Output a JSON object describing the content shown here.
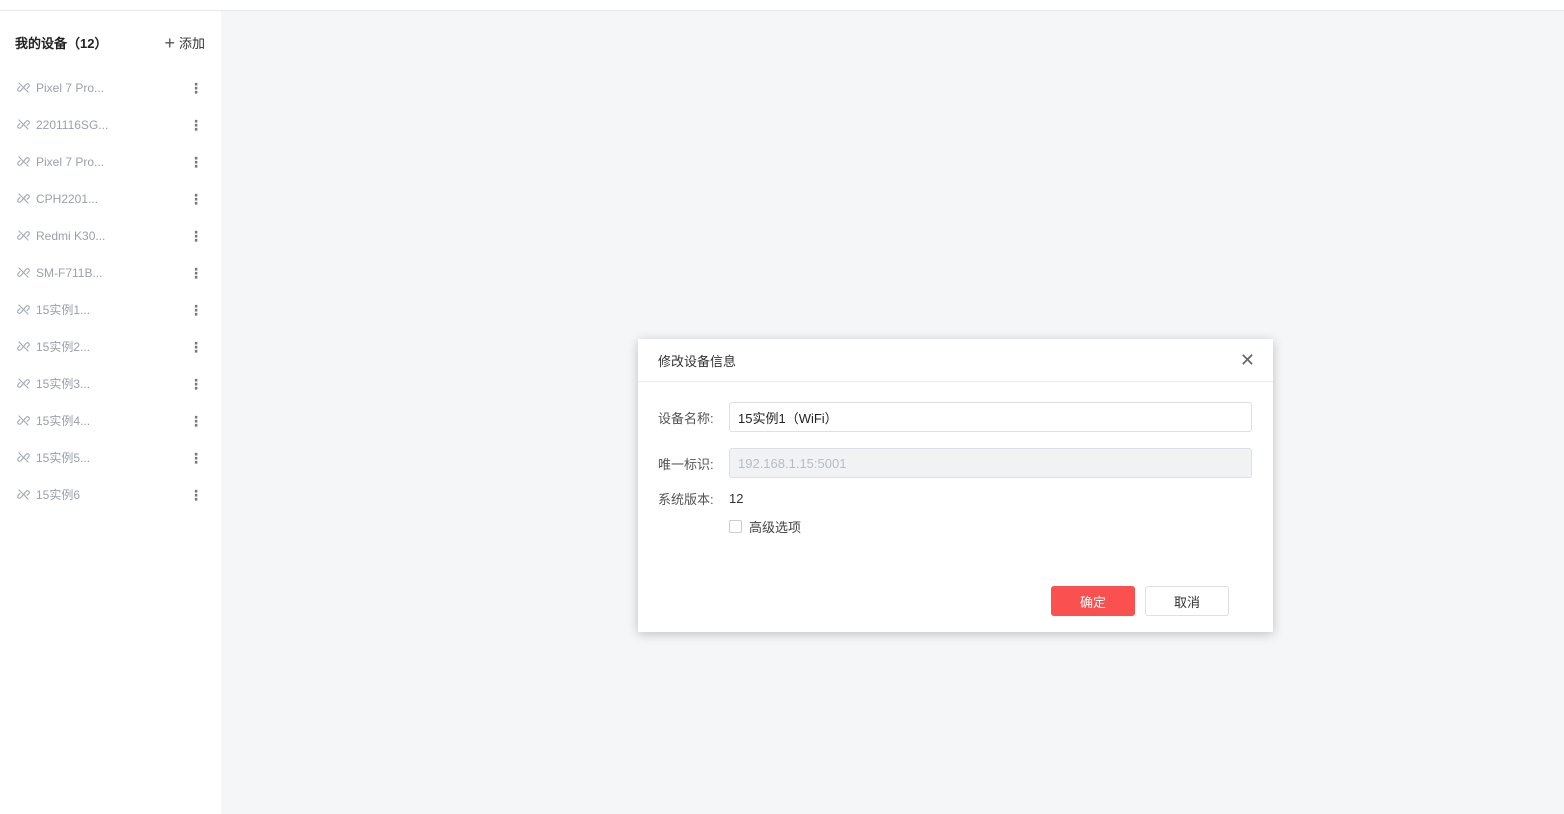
{
  "sidebar": {
    "title": "我的设备（12）",
    "add_label": "添加",
    "items": [
      {
        "label": "Pixel 7 Pro..."
      },
      {
        "label": "2201116SG..."
      },
      {
        "label": "Pixel 7 Pro..."
      },
      {
        "label": "CPH2201..."
      },
      {
        "label": "Redmi K30..."
      },
      {
        "label": "SM-F711B..."
      },
      {
        "label": "15实例1..."
      },
      {
        "label": "15实例2..."
      },
      {
        "label": "15实例3..."
      },
      {
        "label": "15实例4..."
      },
      {
        "label": "15实例5..."
      },
      {
        "label": "15实例6"
      }
    ]
  },
  "dialog": {
    "title": "修改设备信息",
    "name_label": "设备名称:",
    "name_value": "15实例1（WiFi）",
    "id_label": "唯一标识:",
    "id_value": "192.168.1.15:5001",
    "version_label": "系统版本:",
    "version_value": "12",
    "advanced_label": "高级选项",
    "ok_label": "确定",
    "cancel_label": "取消"
  },
  "colors": {
    "accent": "#fa5050",
    "main_bg": "#f5f6f8"
  }
}
